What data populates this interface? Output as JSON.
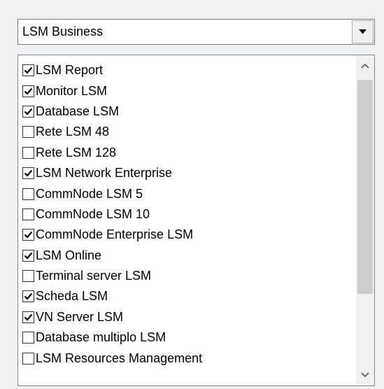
{
  "combo": {
    "selected": "LSM Business",
    "arrow_icon": "triangle-down-icon"
  },
  "list": {
    "items": [
      {
        "label": "LSM Report",
        "checked": true
      },
      {
        "label": "Monitor LSM",
        "checked": true
      },
      {
        "label": "Database LSM",
        "checked": true
      },
      {
        "label": "Rete LSM 48",
        "checked": false
      },
      {
        "label": "Rete LSM 128",
        "checked": false
      },
      {
        "label": "LSM Network Enterprise",
        "checked": true
      },
      {
        "label": "CommNode LSM 5",
        "checked": false
      },
      {
        "label": "CommNode LSM 10",
        "checked": false
      },
      {
        "label": "CommNode Enterprise LSM",
        "checked": true
      },
      {
        "label": "LSM Online",
        "checked": true
      },
      {
        "label": "Terminal server LSM",
        "checked": false
      },
      {
        "label": "Scheda LSM",
        "checked": true
      },
      {
        "label": "VN Server LSM",
        "checked": true
      },
      {
        "label": "Database multiplo LSM",
        "checked": false
      },
      {
        "label": "LSM Resources Management",
        "checked": false
      }
    ]
  },
  "scrollbar": {
    "up_icon": "chevron-up-icon",
    "down_icon": "chevron-down-icon",
    "position": 0
  },
  "colors": {
    "window_bg": "#f0f0f0",
    "list_bg": "#ffffff",
    "thumb": "#cdcdcd"
  }
}
